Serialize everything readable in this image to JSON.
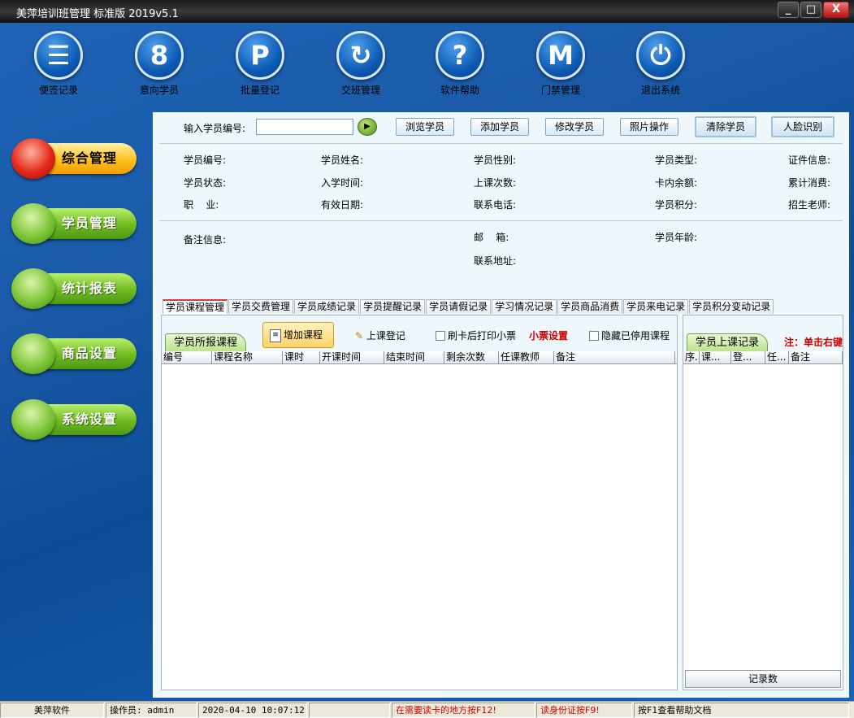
{
  "window": {
    "title": "美萍培训班管理 标准版  2019v5.1",
    "minimize": "_",
    "maximize": "□",
    "close": "X"
  },
  "toolbar": [
    {
      "label": "便签记录",
      "glyph": "☰"
    },
    {
      "label": "意向学员",
      "glyph": "8"
    },
    {
      "label": "批量登记",
      "glyph": "P"
    },
    {
      "label": "交班管理",
      "glyph": "↻"
    },
    {
      "label": "软件帮助",
      "glyph": "?"
    },
    {
      "label": "门禁管理",
      "glyph": "M"
    },
    {
      "label": "退出系统",
      "glyph": "⏻"
    }
  ],
  "nav": [
    {
      "label": "综合管理",
      "active": true
    },
    {
      "label": "学员管理",
      "active": false
    },
    {
      "label": "统计报表",
      "active": false
    },
    {
      "label": "商品设置",
      "active": false
    },
    {
      "label": "系统设置",
      "active": false
    }
  ],
  "search": {
    "label": "输入学员编号:",
    "value": ""
  },
  "buttons": {
    "browse": "浏览学员",
    "add": "添加学员",
    "edit": "修改学员",
    "photo": "照片操作",
    "clear": "清除学员",
    "face": "人脸识别"
  },
  "info": {
    "id": "学员编号:",
    "name": "学员姓名:",
    "gender": "学员性别:",
    "type": "学员类型:",
    "cert": "证件信息:",
    "status": "学员状态:",
    "enroll": "入学时间:",
    "classes": "上课次数:",
    "balance": "卡内余额:",
    "consume": "累计消费:",
    "job": "职    业:",
    "valid": "有效日期:",
    "phone": "联系电话:",
    "points": "学员积分:",
    "teacher": "招生老师:",
    "remark": "备注信息:",
    "email": "邮    箱:",
    "age": "学员年龄:",
    "address": "联系地址:"
  },
  "tabs": [
    "学员课程管理",
    "学员交费管理",
    "学员成绩记录",
    "学员提醒记录",
    "学员请假记录",
    "学习情况记录",
    "学员商品消费",
    "学员来电记录",
    "学员积分变动记录"
  ],
  "course_pane": {
    "subtab": "学员所报课程",
    "add_button": "增加课程",
    "checkin": "上课登记",
    "print_receipt": "刷卡后打印小票",
    "receipt_setting": "小票设置",
    "hide_disabled": "隐藏已停用课程",
    "columns": [
      "编号",
      "课程名称",
      "课时",
      "开课时间",
      "结束时间",
      "剩余次数",
      "任课教师",
      "备注"
    ]
  },
  "record_pane": {
    "subtab": "学员上课记录",
    "note": "注：单击右键",
    "columns": [
      "序.",
      "课...",
      "登...",
      "任...",
      "备注"
    ],
    "footer": "记录数"
  },
  "status": {
    "company": "美萍软件",
    "operator": "操作员: admin",
    "datetime": "2020-04-10 10:07:12",
    "blank": "",
    "f12": "在需要读卡的地方按F12!",
    "f9": "读身份证按F9!",
    "f1": "按F1查看帮助文档"
  }
}
